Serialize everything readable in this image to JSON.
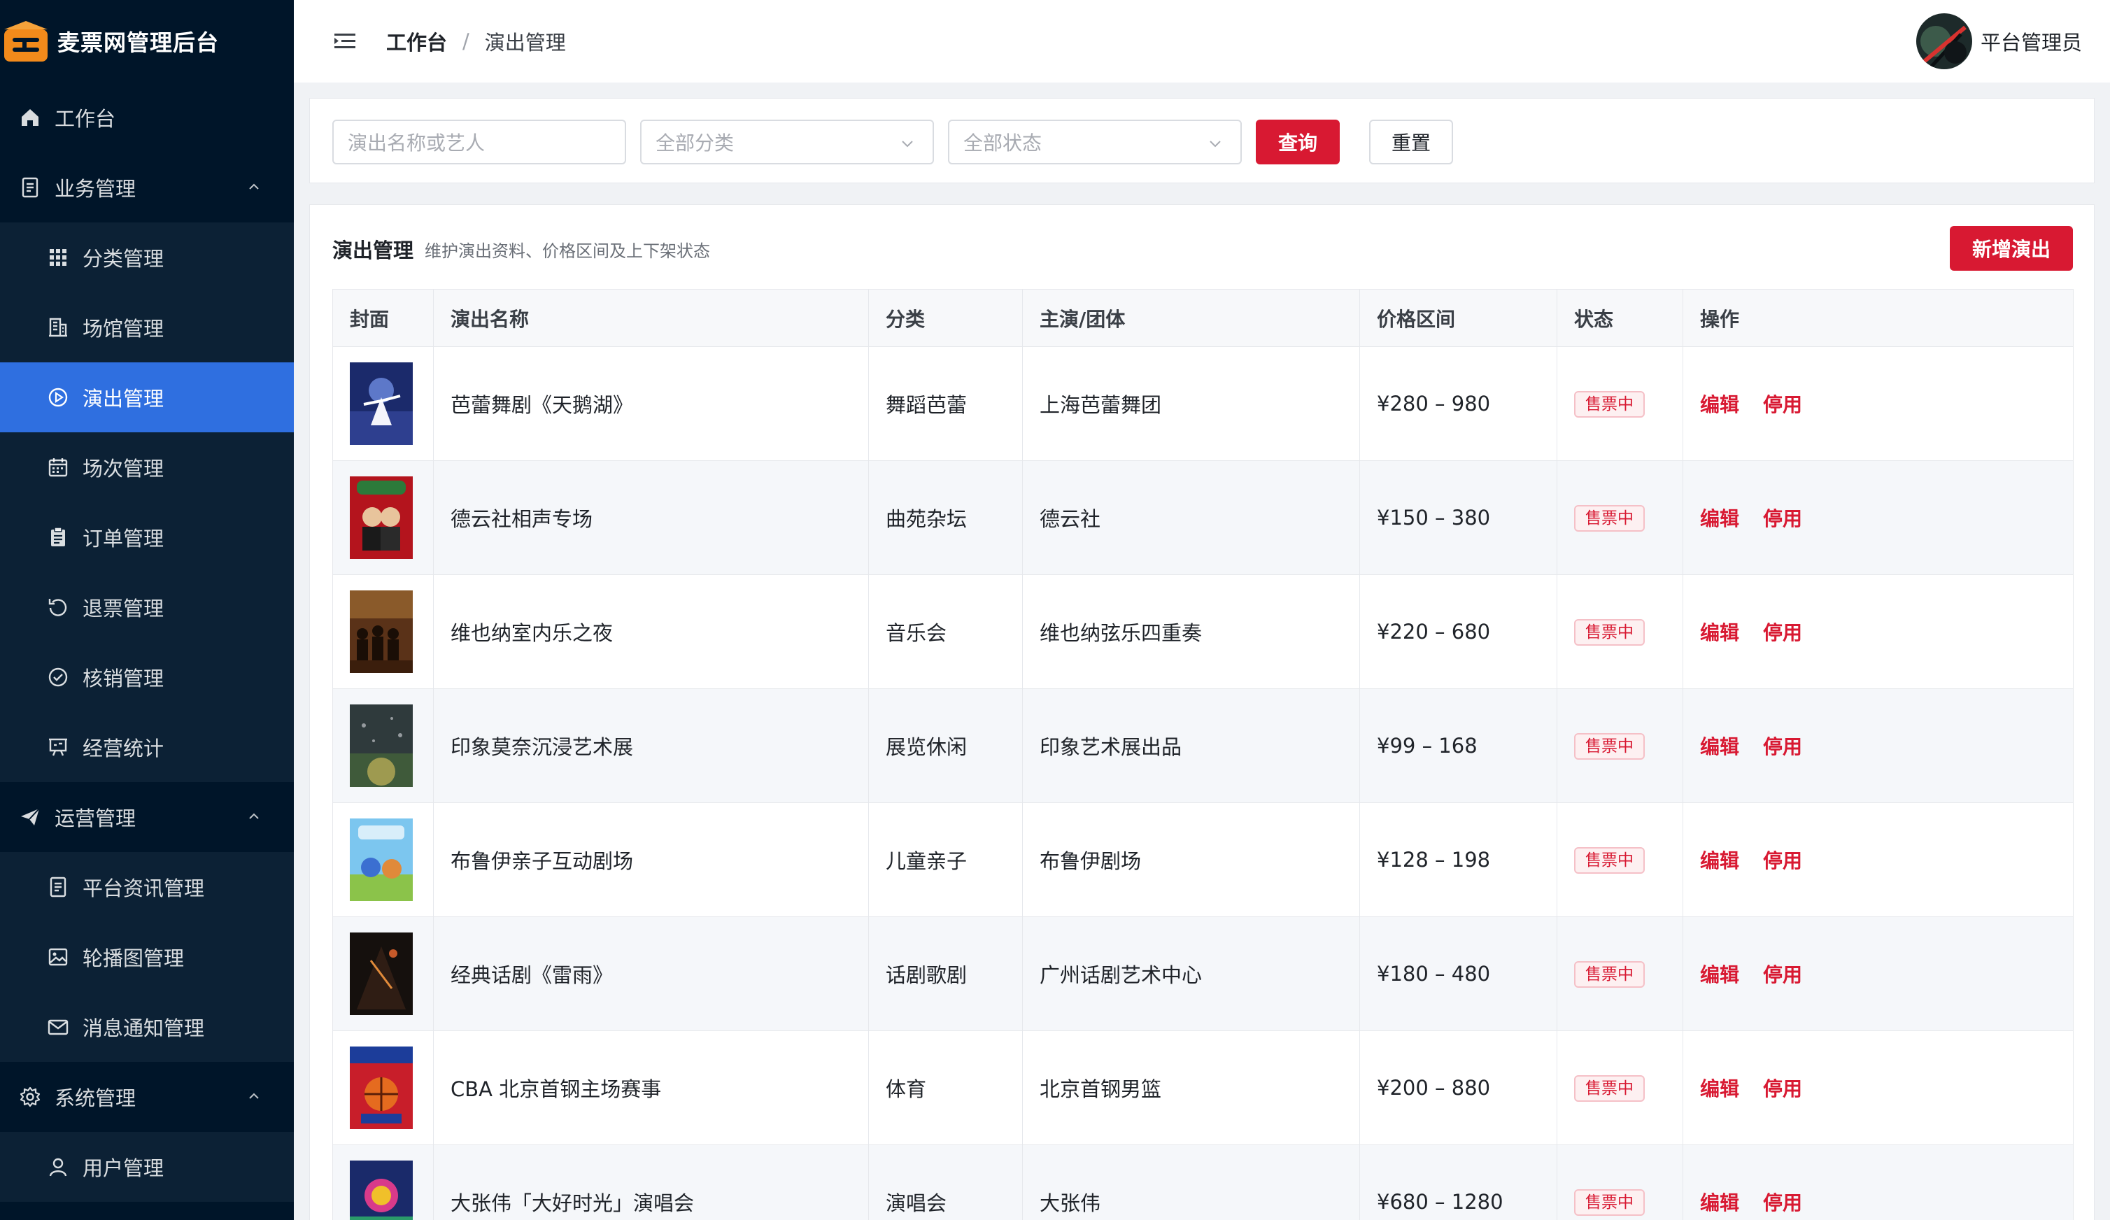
{
  "app": {
    "title": "麦票网管理后台"
  },
  "sidebar": {
    "items": [
      {
        "label": "工作台",
        "icon": "home-icon",
        "level": "top"
      },
      {
        "label": "业务管理",
        "icon": "document-icon",
        "level": "top",
        "expanded": true
      },
      {
        "label": "分类管理",
        "icon": "grid-icon",
        "level": "sub"
      },
      {
        "label": "场馆管理",
        "icon": "building-icon",
        "level": "sub"
      },
      {
        "label": "演出管理",
        "icon": "play-circle-icon",
        "level": "sub",
        "active": true
      },
      {
        "label": "场次管理",
        "icon": "calendar-icon",
        "level": "sub"
      },
      {
        "label": "订单管理",
        "icon": "clipboard-icon",
        "level": "sub"
      },
      {
        "label": "退票管理",
        "icon": "refresh-icon",
        "level": "sub"
      },
      {
        "label": "核销管理",
        "icon": "check-circle-icon",
        "level": "sub"
      },
      {
        "label": "经营统计",
        "icon": "presentation-icon",
        "level": "sub"
      },
      {
        "label": "运营管理",
        "icon": "send-icon",
        "level": "top",
        "expanded": true
      },
      {
        "label": "平台资讯管理",
        "icon": "document-icon",
        "level": "sub"
      },
      {
        "label": "轮播图管理",
        "icon": "image-icon",
        "level": "sub"
      },
      {
        "label": "消息通知管理",
        "icon": "mail-icon",
        "level": "sub"
      },
      {
        "label": "系统管理",
        "icon": "gear-icon",
        "level": "top",
        "expanded": true
      },
      {
        "label": "用户管理",
        "icon": "user-icon",
        "level": "sub"
      }
    ]
  },
  "header": {
    "breadcrumb": {
      "home": "工作台",
      "separator": "/",
      "current": "演出管理"
    },
    "user": {
      "name": "平台管理员"
    }
  },
  "filters": {
    "keyword_placeholder": "演出名称或艺人",
    "category_value": "全部分类",
    "status_value": "全部状态",
    "search_label": "查询",
    "reset_label": "重置"
  },
  "list": {
    "title": "演出管理",
    "description": "维护演出资料、价格区间及上下架状态",
    "add_label": "新增演出",
    "columns": [
      "封面",
      "演出名称",
      "分类",
      "主演/团体",
      "价格区间",
      "状态",
      "操作"
    ],
    "rows": [
      {
        "name": "芭蕾舞剧《天鹅湖》",
        "category": "舞蹈芭蕾",
        "performer": "上海芭蕾舞团",
        "price": "¥280 – 980",
        "status": "售票中",
        "cover": "ballet"
      },
      {
        "name": "德云社相声专场",
        "category": "曲苑杂坛",
        "performer": "德云社",
        "price": "¥150 – 380",
        "status": "售票中",
        "cover": "crosstalk"
      },
      {
        "name": "维也纳室内乐之夜",
        "category": "音乐会",
        "performer": "维也纳弦乐四重奏",
        "price": "¥220 – 680",
        "status": "售票中",
        "cover": "orchestra"
      },
      {
        "name": "印象莫奈沉浸艺术展",
        "category": "展览休闲",
        "performer": "印象艺术展出品",
        "price": "¥99 – 168",
        "status": "售票中",
        "cover": "monet"
      },
      {
        "name": "布鲁伊亲子互动剧场",
        "category": "儿童亲子",
        "performer": "布鲁伊剧场",
        "price": "¥128 – 198",
        "status": "售票中",
        "cover": "bluey"
      },
      {
        "name": "经典话剧《雷雨》",
        "category": "话剧歌剧",
        "performer": "广州话剧艺术中心",
        "price": "¥180 – 480",
        "status": "售票中",
        "cover": "drama"
      },
      {
        "name": "CBA 北京首钢主场赛事",
        "category": "体育",
        "performer": "北京首钢男篮",
        "price": "¥200 – 880",
        "status": "售票中",
        "cover": "basketball"
      },
      {
        "name": "大张伟「大好时光」演唱会",
        "category": "演唱会",
        "performer": "大张伟",
        "price": "¥680 – 1280",
        "status": "售票中",
        "cover": "concert"
      }
    ],
    "actions": {
      "edit": "编辑",
      "disable": "停用"
    }
  },
  "colors": {
    "sidebar_bg": "#001529",
    "active_menu": "#2f6fe0",
    "brand_red": "#d81932"
  }
}
